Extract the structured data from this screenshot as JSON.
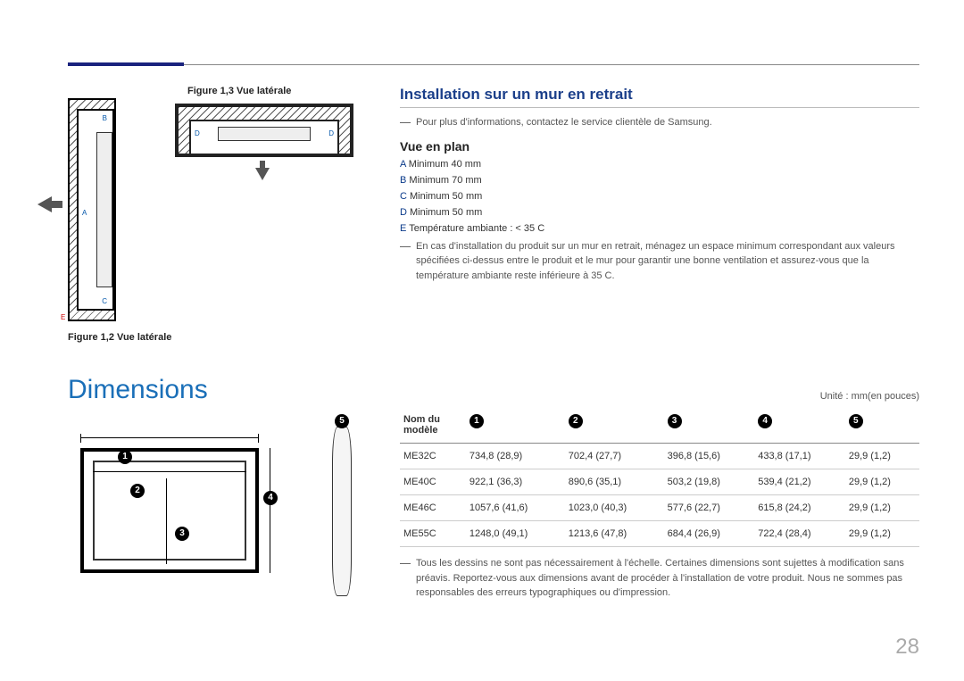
{
  "page_number": "28",
  "figures": {
    "fig13_label": "Figure 1,3 Vue latérale",
    "fig12_label": "Figure 1,2 Vue latérale",
    "side_markers": {
      "A": "A",
      "B": "B",
      "C": "C",
      "D": "D",
      "E": "E"
    }
  },
  "section": {
    "heading": "Installation sur un mur en retrait",
    "note_top": "Pour plus d'informations, contactez le service clientèle de Samsung.",
    "sub_heading": "Vue en plan",
    "specs": {
      "A": {
        "key": "A",
        "text": "Minimum 40 mm"
      },
      "B": {
        "key": "B",
        "text": "Minimum 70 mm"
      },
      "C": {
        "key": "C",
        "text": "Minimum 50 mm"
      },
      "D": {
        "key": "D",
        "text": "Minimum 50 mm"
      },
      "E": {
        "key": "E",
        "text": "Température ambiante : < 35 C"
      }
    },
    "note_bottom": "En cas d'installation du produit sur un mur en retrait, ménagez un espace minimum correspondant aux valeurs spécifiées ci-dessus entre le produit et le mur pour garantir une bonne ventilation et assurez-vous que la température ambiante reste inférieure à 35 C."
  },
  "dimensions": {
    "title": "Dimensions",
    "unit_note": "Unité : mm(en pouces)",
    "col_model_l1": "Nom du",
    "col_model_l2": "modèle",
    "circles": {
      "1": "1",
      "2": "2",
      "3": "3",
      "4": "4",
      "5": "5"
    },
    "rows": [
      {
        "model": "ME32C",
        "c1": "734,8 (28,9)",
        "c2": "702,4 (27,7)",
        "c3": "396,8 (15,6)",
        "c4": "433,8 (17,1)",
        "c5": "29,9 (1,2)"
      },
      {
        "model": "ME40C",
        "c1": "922,1 (36,3)",
        "c2": "890,6 (35,1)",
        "c3": "503,2 (19,8)",
        "c4": "539,4 (21,2)",
        "c5": "29,9 (1,2)"
      },
      {
        "model": "ME46C",
        "c1": "1057,6 (41,6)",
        "c2": "1023,0 (40,3)",
        "c3": "577,6 (22,7)",
        "c4": "615,8 (24,2)",
        "c5": "29,9 (1,2)"
      },
      {
        "model": "ME55C",
        "c1": "1248,0 (49,1)",
        "c2": "1213,6 (47,8)",
        "c3": "684,4 (26,9)",
        "c4": "722,4 (28,4)",
        "c5": "29,9 (1,2)"
      }
    ],
    "footnote": "Tous les dessins ne sont pas nécessairement à l'échelle. Certaines dimensions sont sujettes à modification sans préavis. Reportez-vous aux dimensions avant de procéder à l'installation de votre produit. Nous ne sommes pas responsables des erreurs typographiques ou d'impression."
  }
}
